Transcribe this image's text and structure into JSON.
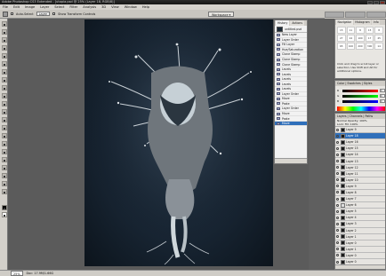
{
  "window": {
    "title": "Adobe Photoshop CS3 Extended - [utopia.psd @ 25% (Layer 18, RGB/8)]"
  },
  "menu": [
    "File",
    "Edit",
    "Image",
    "Layer",
    "Select",
    "Filter",
    "Analysis",
    "3D",
    "View",
    "Window",
    "Help"
  ],
  "options": {
    "auto_select": "Auto-Select",
    "target": "Layer",
    "show_transform": "Show Transform Controls",
    "workspace": "Workspace ▾"
  },
  "status": {
    "zoom": "25%",
    "doc": "Doc: 17.9M/1.66G"
  },
  "history": {
    "tabs": [
      "History",
      "Actions"
    ],
    "snapshot": "untitled.psd",
    "items": [
      "New Layer",
      "Layer Order",
      "Fill Layer",
      "Hue/Saturation",
      "Clone Stamp",
      "Clone Stamp",
      "Clone Stamp",
      "Levels",
      "Levels",
      "Levels",
      "Levels",
      "Levels",
      "Layer Order",
      "Move",
      "Paste",
      "Layer Order",
      "Move",
      "Paste",
      "Move"
    ],
    "active_index": 18
  },
  "navigator": {
    "tabs": [
      "Navigator",
      "Histogram",
      "Info"
    ],
    "brushes": [
      "15",
      "11",
      "8",
      "15",
      "8",
      "27",
      "24",
      "100",
      "17",
      "45",
      "65",
      "100",
      "200",
      "300",
      "14"
    ],
    "note": "Click and drag to scroll layer or selection. Use Shift and Alt for additional options."
  },
  "color": {
    "tabs": "Color | Swatches | Styles",
    "labels": [
      "R",
      "G",
      "B"
    ],
    "values": [
      "0",
      "0",
      "0"
    ]
  },
  "layers": {
    "tabs": "Layers | Channels | Paths",
    "mode": "Normal",
    "opacity": "Opacity: 100%",
    "lock": "Lock:",
    "fill": "Fill: 100%",
    "items": [
      "Layer 9",
      "Layer 18",
      "Layer 16",
      "Layer 15",
      "Layer 14",
      "Layer 13",
      "Layer 12",
      "Layer 11",
      "Layer 10",
      "Layer 9",
      "Layer 8",
      "Layer 7",
      "Layer 6",
      "Layer 5",
      "Layer 4",
      "Layer 3",
      "Layer 2",
      "Layer 1",
      "Layer 0",
      "Layer 1",
      "Layer 0",
      "Layer 0"
    ],
    "active_index": 1
  }
}
